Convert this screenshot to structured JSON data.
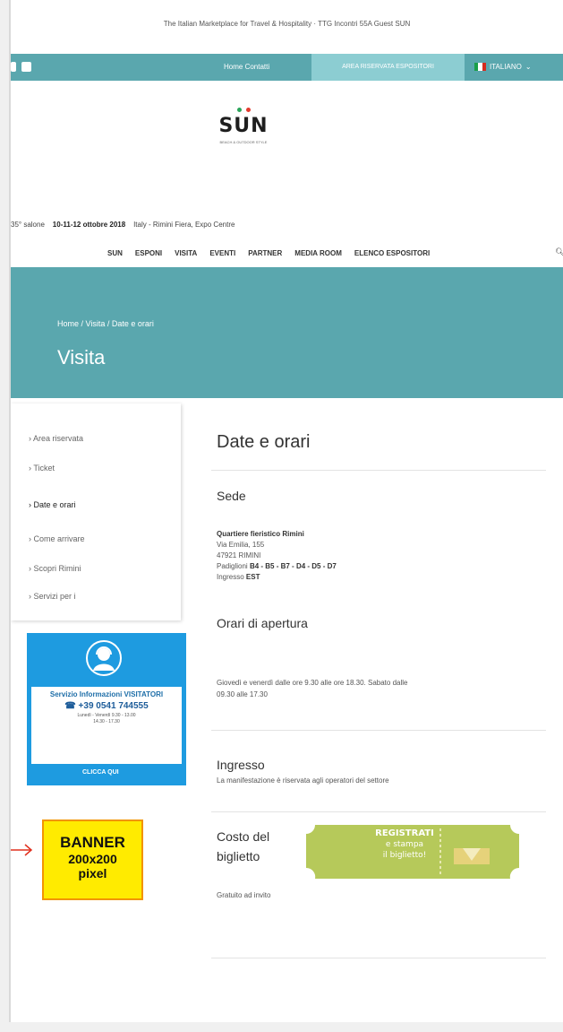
{
  "top": {
    "tagline": "The Italian Marketplace for Travel & Hospitality · TTG Incontri 55A Guest SUN",
    "home_link": "Home Contatti",
    "reserved_area": "AREA RISERVATA ESPOSITORI",
    "language": "ITALIANO"
  },
  "brand": {
    "logo": "SUN",
    "logo_sub": "BEACH & OUTDOOR STYLE"
  },
  "event": {
    "edition": "35° salone",
    "dates": "10-11-12 ottobre 2018",
    "place": "Italy - Rimini Fiera, Expo Centre"
  },
  "nav": {
    "items": [
      "SUN",
      "ESPONI",
      "VISITA",
      "EVENTI",
      "PARTNER",
      "MEDIA ROOM",
      "ELENCO ESPOSITORI"
    ]
  },
  "banner": {
    "breadcrumb": "Home / Visita / Date e orari",
    "title": "Visita"
  },
  "sidebar": {
    "items": [
      "Area riservata",
      "Ticket",
      "Date e orari",
      "Come arrivare",
      "Scopri Rimini",
      "Servizi per i"
    ]
  },
  "contact": {
    "title": "Servizio Informazioni VISITATORI",
    "phone": "+39 0541 744555",
    "hours_1": "Lunedì - Venerdì  9.30 - 13.00",
    "hours_2": "14.30 - 17.30",
    "button": "CLICCA QUI"
  },
  "promo": {
    "line1": "BANNER",
    "line2": "200x200",
    "line3": "pixel"
  },
  "content": {
    "title": "Date e orari",
    "venue_heading": "Sede",
    "venue_name": "Quartiere fieristico Rimini",
    "venue_street": "Via Emilia, 155",
    "venue_city": "47921 RIMINI",
    "pavilions_label": "Padiglioni",
    "pavilions": "B4 - B5 - B7 - D4 - D5 - D7",
    "entrance_label": "Ingresso",
    "entrance": "EST",
    "hours_heading": "Orari di apertura",
    "hours_text_1": "Giovedì e venerdì dalle ore 9.30 alle ore 18.30. Sabato dalle",
    "hours_text_2": "09.30 alle 17.30",
    "entry_heading": "Ingresso",
    "entry_text": "La manifestazione è riservata agli operatori del settore",
    "cost_heading_1": "Costo del",
    "cost_heading_2": "biglietto",
    "cost_text": "Gratuito ad invito",
    "ticket_banner_1": "REGISTRATI",
    "ticket_banner_2": "e stampa",
    "ticket_banner_3": "il biglietto!"
  },
  "colors": {
    "teal": "#5aa7ae",
    "teal_light": "#8ccdd2",
    "contact_blue": "#1e9be0",
    "promo_yellow": "#ffeb00",
    "promo_border": "#f29400",
    "ticket_green": "#b6c95a"
  }
}
